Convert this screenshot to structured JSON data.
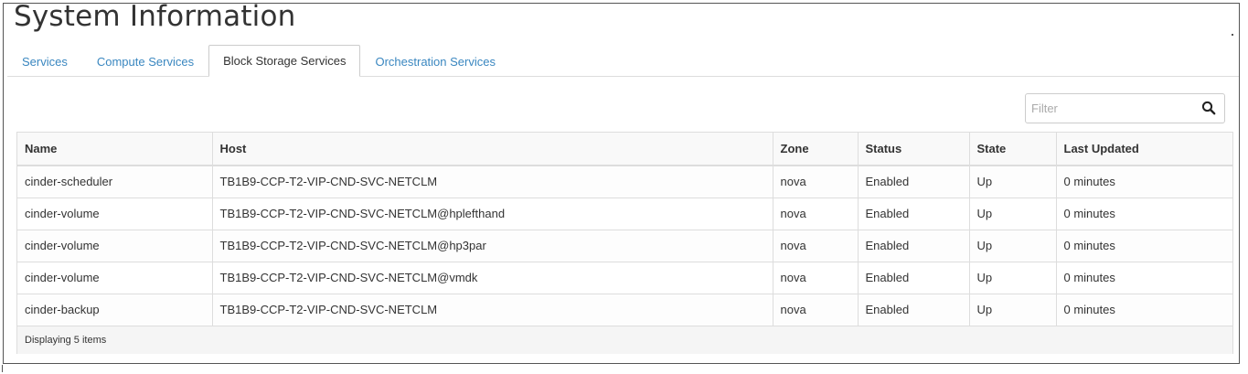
{
  "page": {
    "title": "System Information"
  },
  "tabs": [
    {
      "label": "Services",
      "active": false
    },
    {
      "label": "Compute Services",
      "active": false
    },
    {
      "label": "Block Storage Services",
      "active": true
    },
    {
      "label": "Orchestration Services",
      "active": false
    }
  ],
  "filter": {
    "placeholder": "Filter",
    "value": "",
    "icon": "search-icon"
  },
  "table": {
    "columns": [
      "Name",
      "Host",
      "Zone",
      "Status",
      "State",
      "Last Updated"
    ],
    "rows": [
      [
        "cinder-scheduler",
        "TB1B9-CCP-T2-VIP-CND-SVC-NETCLM",
        "nova",
        "Enabled",
        "Up",
        "0 minutes"
      ],
      [
        "cinder-volume",
        "TB1B9-CCP-T2-VIP-CND-SVC-NETCLM@hplefthand",
        "nova",
        "Enabled",
        "Up",
        "0 minutes"
      ],
      [
        "cinder-volume",
        "TB1B9-CCP-T2-VIP-CND-SVC-NETCLM@hp3par",
        "nova",
        "Enabled",
        "Up",
        "0 minutes"
      ],
      [
        "cinder-volume",
        "TB1B9-CCP-T2-VIP-CND-SVC-NETCLM@vmdk",
        "nova",
        "Enabled",
        "Up",
        "0 minutes"
      ],
      [
        "cinder-backup",
        "TB1B9-CCP-T2-VIP-CND-SVC-NETCLM",
        "nova",
        "Enabled",
        "Up",
        "0 minutes"
      ]
    ],
    "footer": "Displaying 5 items"
  },
  "colors": {
    "link": "#3a87c0",
    "text": "#333333",
    "border": "#dddddd"
  }
}
